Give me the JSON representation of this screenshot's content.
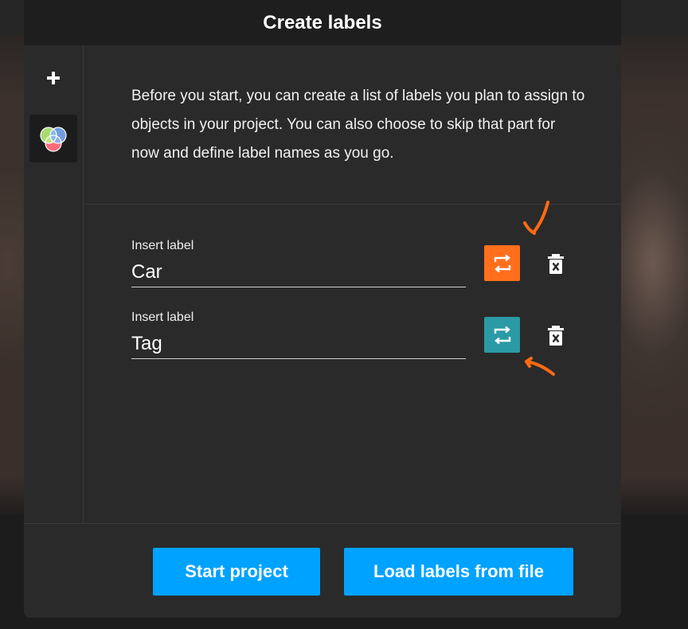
{
  "modal": {
    "title": "Create labels"
  },
  "sidebar": {
    "add_icon": "plus-icon",
    "color_icon": "color-circles-icon"
  },
  "description": "Before you start, you can create a list of labels you plan to assign to objects in your project. You can also choose to skip that part for now and define label names as you go.",
  "labels": [
    {
      "caption": "Insert label",
      "value": "Car",
      "color": "#ff6f1c"
    },
    {
      "caption": "Insert label",
      "value": "Tag",
      "color": "#2a9aa6"
    }
  ],
  "buttons": {
    "start": "Start project",
    "load": "Load labels from file"
  },
  "colors": {
    "accent": "#00a2ff",
    "annotation": "#ff6a13"
  }
}
